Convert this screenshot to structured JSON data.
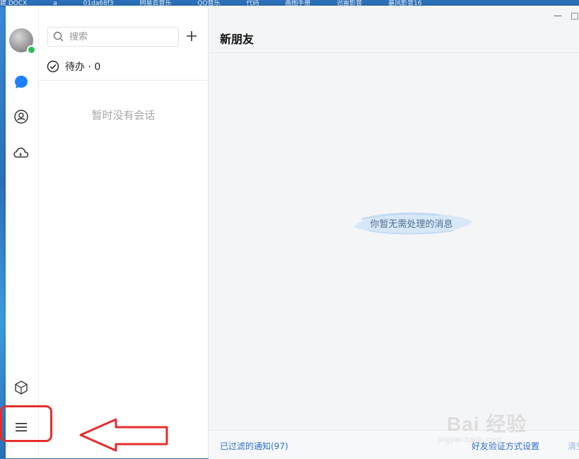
{
  "desktop": {
    "topbar_items": [
      "建 DOCX",
      "a",
      "01da68f3",
      "网易云音乐",
      "QQ音乐",
      "代码",
      "画图手册",
      "迅雷影音",
      "暴风影音16"
    ]
  },
  "rail": {
    "icons": [
      "avatar",
      "chat-bubble-icon",
      "contacts-icon",
      "cloud-icon",
      "cube-icon",
      "menu-icon"
    ]
  },
  "list": {
    "search_placeholder": "搜索",
    "add_label": "+",
    "todo_label": "待办 · 0",
    "empty_label": "暂时没有会话"
  },
  "main": {
    "title": "新朋友",
    "empty_message": "你暂无需处理的消息",
    "footer": {
      "filtered_link": "已过滤的通知(97)",
      "verify_link": "好友验证方式设置",
      "clear_link": "清空"
    },
    "window_controls": {
      "minimize": "—",
      "maximize": "□"
    }
  },
  "watermark": {
    "text": "Bai 经验",
    "url": "jingyan.baidu.com"
  },
  "colors": {
    "accent": "#2d6fd0",
    "chat_icon": "#1e80ff",
    "status_online": "#2bbd5a",
    "annotation": "#e52d2d"
  }
}
